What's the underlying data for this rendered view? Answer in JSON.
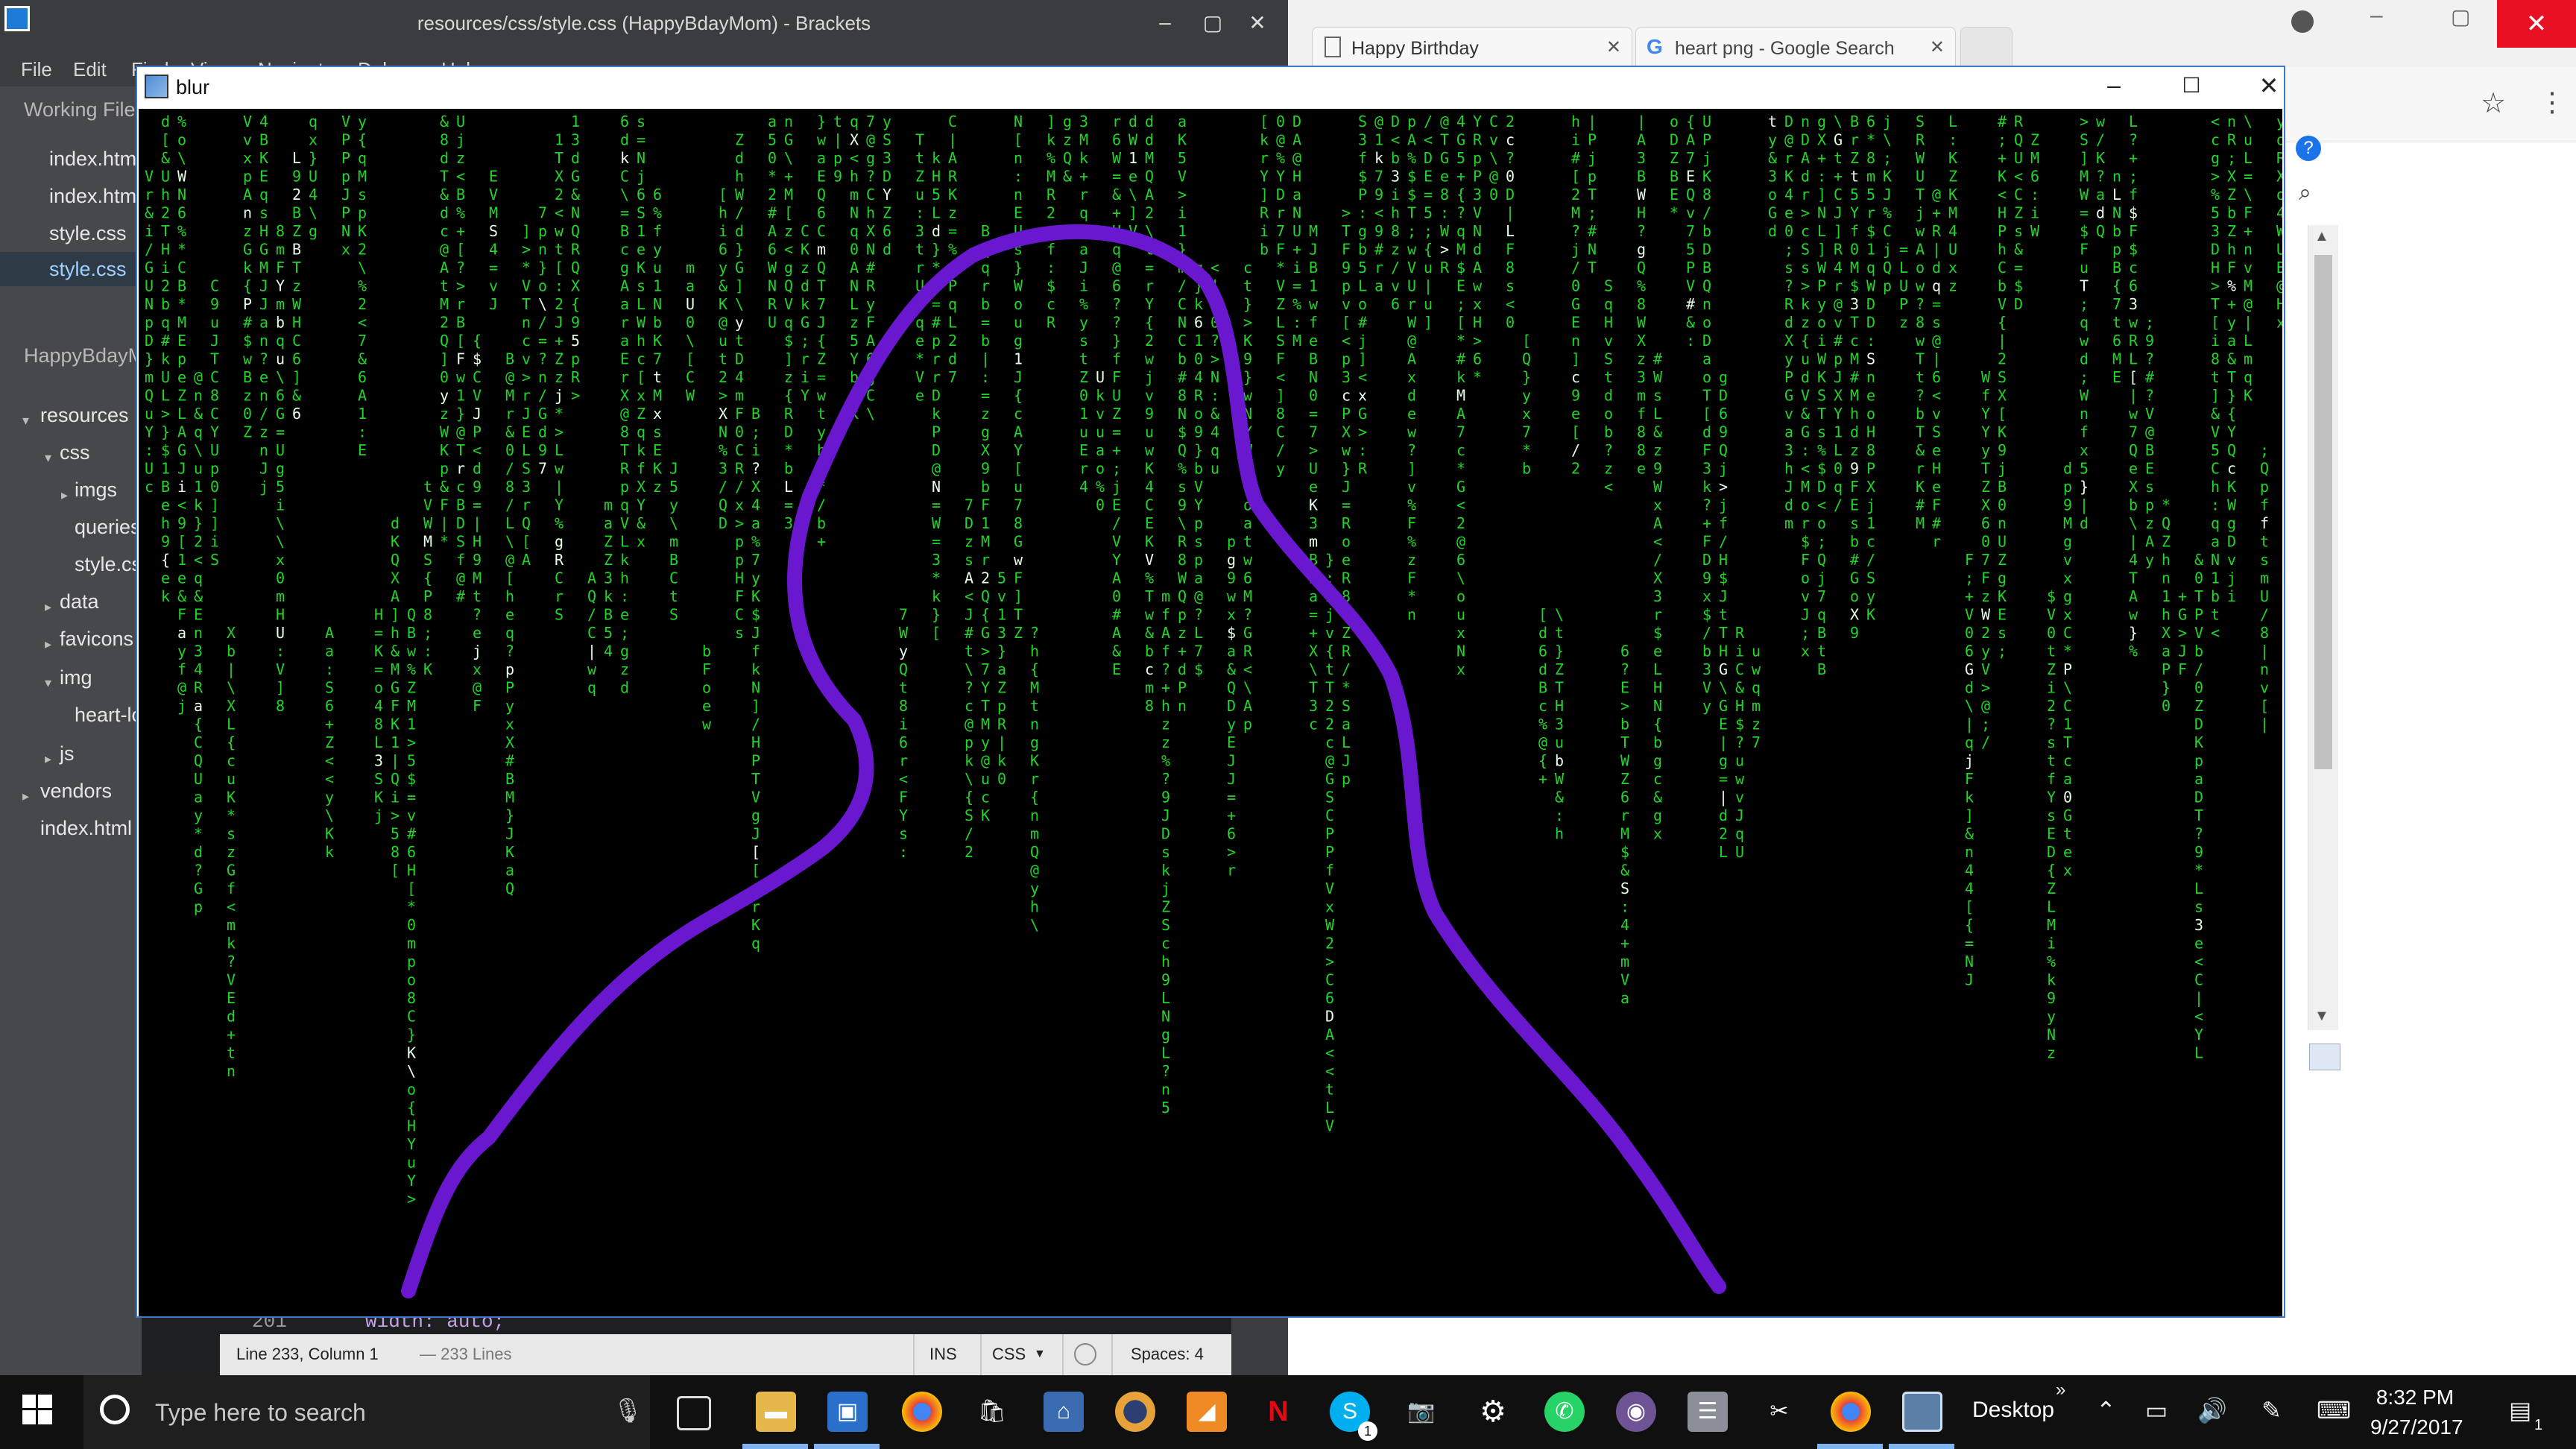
{
  "brackets": {
    "title": "resources/css/style.css (HappyBdayMom) - Brackets",
    "menu": [
      "File",
      "Edit",
      "Find",
      "View",
      "Navigate",
      "Debug",
      "Help"
    ],
    "working_files_label": "Working Files",
    "working_files": [
      "index.html",
      "index.html",
      "style.css",
      "style.css"
    ],
    "project_label": "HappyBdayMom",
    "tree": {
      "resources": "resources",
      "css": "css",
      "imgs": "imgs",
      "queries": "queries",
      "style": "style.css",
      "data": "data",
      "favicons": "favicons",
      "img": "img",
      "heart": "heart-love",
      "js": "js",
      "vendors": "vendors",
      "index": "index.html"
    },
    "code_line_number": "201",
    "code_line_text": "width: auto;",
    "status": {
      "position": "Line 233, Column 1",
      "lines": "— 233 Lines",
      "mode": "INS",
      "language": "CSS",
      "spaces": "Spaces: 4"
    }
  },
  "chrome": {
    "tabs": [
      {
        "label": "Happy Birthday",
        "icon": "page-icon"
      },
      {
        "label": "heart png - Google Search",
        "icon": "google-icon"
      }
    ],
    "account_icon": "account-icon",
    "help_badge": "?"
  },
  "blur_window": {
    "title": "blur",
    "annotation_color": "#6a18d0",
    "matrix_color": "#22d42a"
  },
  "taskbar": {
    "search_placeholder": "Type here to search",
    "desktop_label": "Desktop",
    "time": "8:32 PM",
    "date": "9/27/2017",
    "notification_count": "1",
    "skype_badge": "1"
  }
}
